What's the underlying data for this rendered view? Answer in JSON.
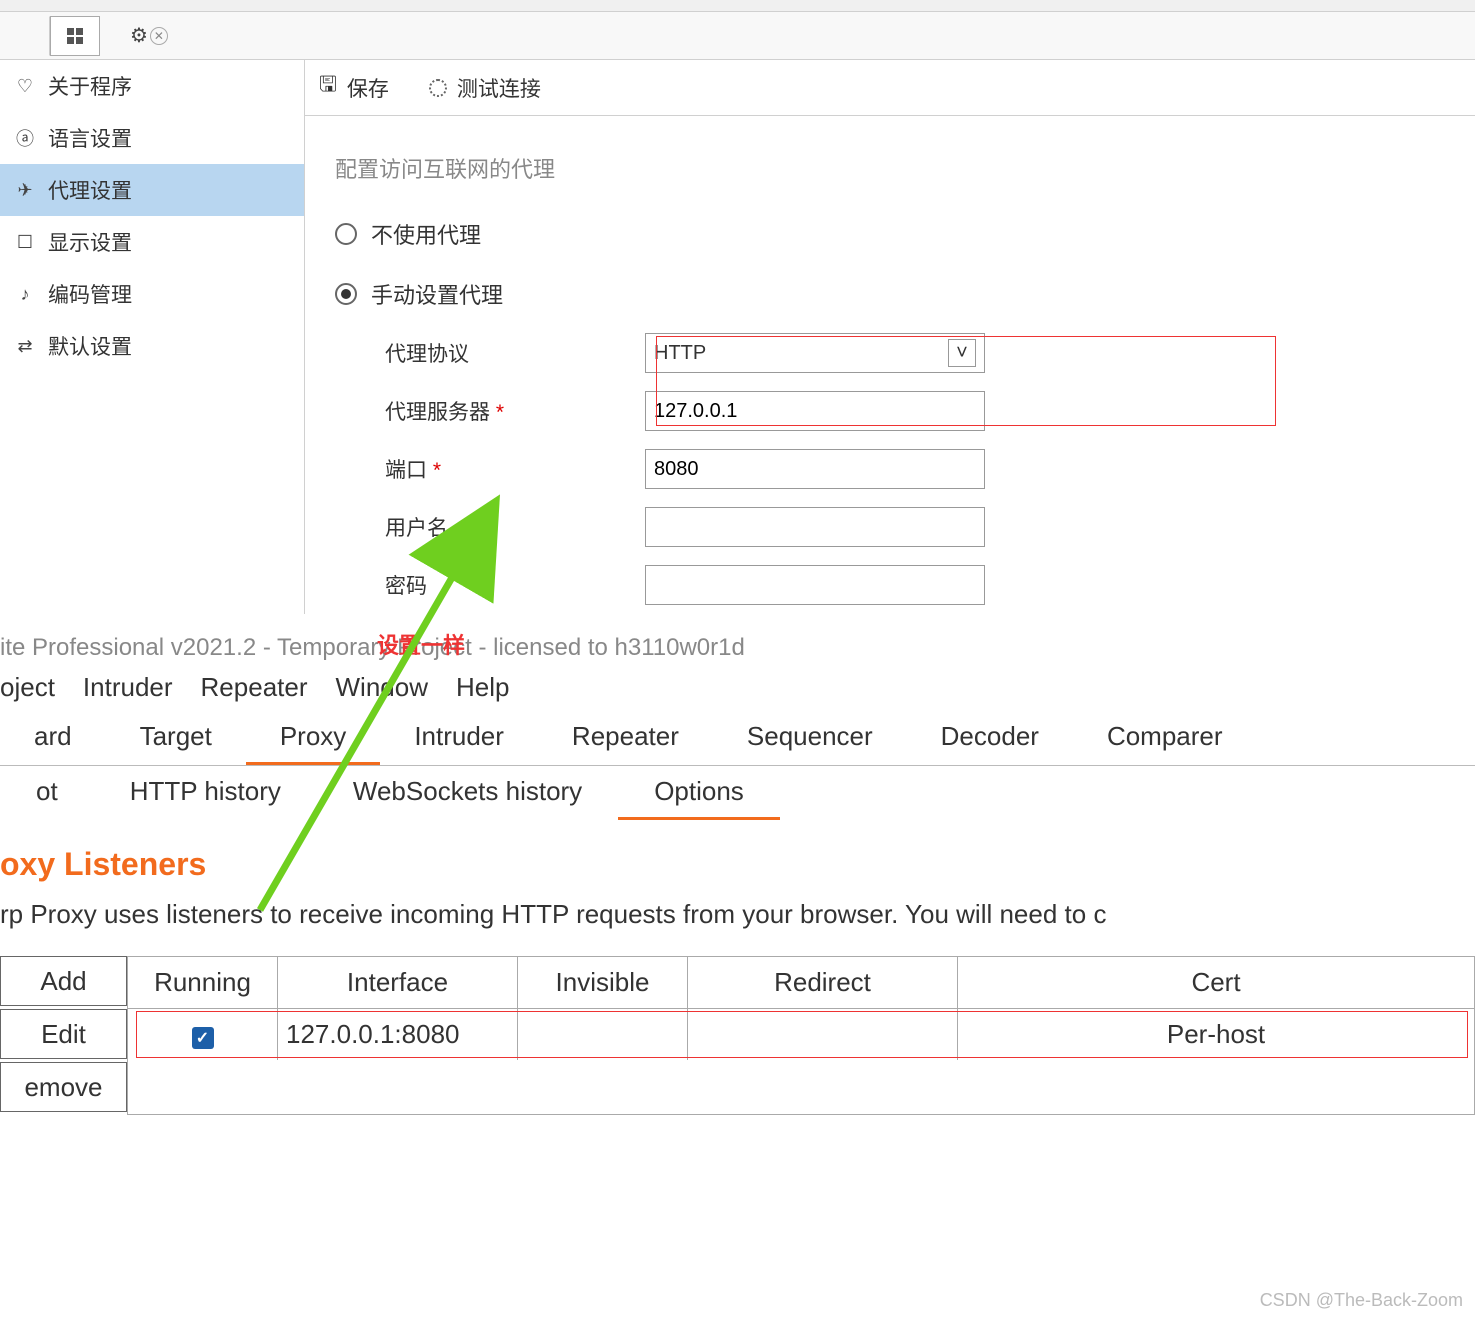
{
  "toolbar": {},
  "sidebar": {
    "items": [
      {
        "icon": "heart",
        "label": "关于程序"
      },
      {
        "icon": "lang",
        "label": "语言设置"
      },
      {
        "icon": "plane",
        "label": "代理设置",
        "selected": true
      },
      {
        "icon": "monitor",
        "label": "显示设置"
      },
      {
        "icon": "music",
        "label": "编码管理"
      },
      {
        "icon": "sliders",
        "label": "默认设置"
      }
    ]
  },
  "content": {
    "save_label": "保存",
    "test_label": "测试连接",
    "section_title": "配置访问互联网的代理",
    "opt_no_proxy": "不使用代理",
    "opt_manual": "手动设置代理",
    "lbl_protocol": "代理协议",
    "val_protocol": "HTTP",
    "lbl_server": "代理服务器",
    "val_server": "127.0.0.1",
    "lbl_port": "端口",
    "val_port": "8080",
    "lbl_user": "用户名",
    "val_user": "",
    "lbl_pass": "密码",
    "val_pass": ""
  },
  "annotation": {
    "text": "设置一样"
  },
  "burp": {
    "title_bar": "ite Professional v2021.2 - Temporary Project - licensed to h3110w0r1d",
    "menus": [
      "oject",
      "Intruder",
      "Repeater",
      "Window",
      "Help"
    ],
    "tabs": [
      "ard",
      "Target",
      "Proxy",
      "Intruder",
      "Repeater",
      "Sequencer",
      "Decoder",
      "Comparer"
    ],
    "selected_tab": 2,
    "subtabs": [
      "ot",
      "HTTP history",
      "WebSockets history",
      "Options"
    ],
    "selected_subtab": 3,
    "heading": "oxy Listeners",
    "desc": "rp Proxy uses listeners to receive incoming HTTP requests from your browser. You will need to c",
    "buttons": {
      "add": "Add",
      "edit": "Edit",
      "remove": "emove"
    },
    "headers": {
      "running": "Running",
      "interface": "Interface",
      "invisible": "Invisible",
      "redirect": "Redirect",
      "cert": "Cert"
    },
    "row": {
      "running": true,
      "interface": "127.0.0.1:8080",
      "invisible": "",
      "redirect": "",
      "cert": "Per-host"
    }
  },
  "watermark": "CSDN @The-Back-Zoom"
}
